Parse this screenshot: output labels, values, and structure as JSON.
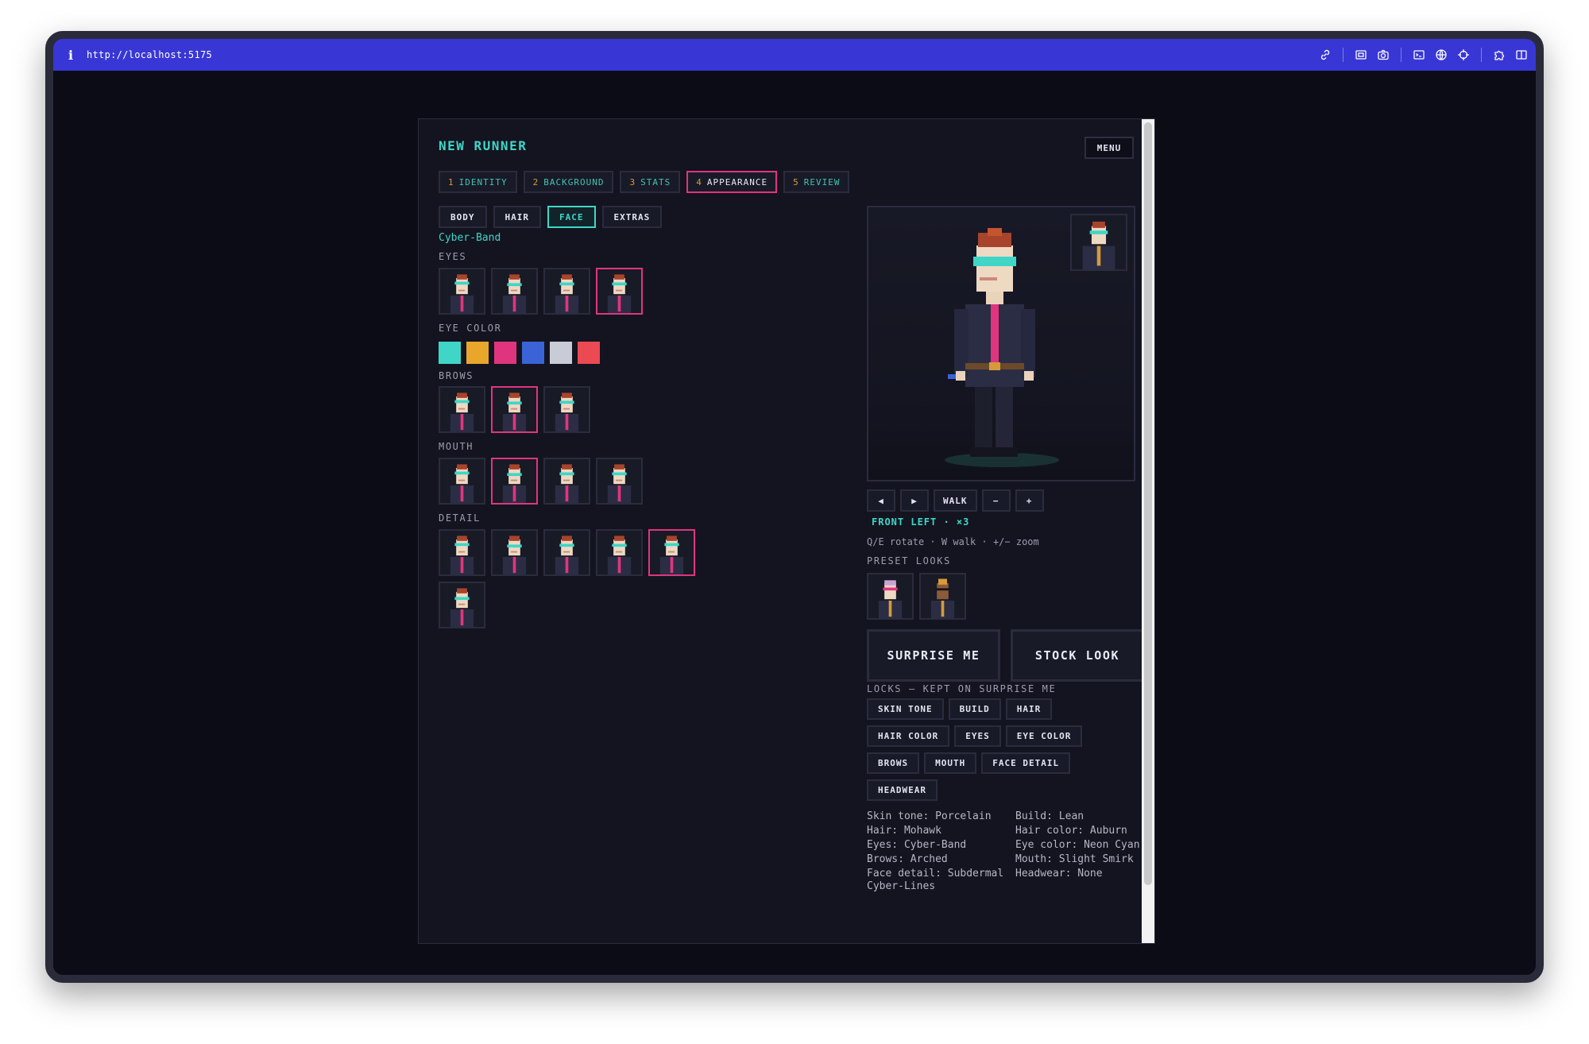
{
  "browser": {
    "url": "http://localhost:5175",
    "icons": [
      "info-icon",
      "link-icon",
      "screenshot-icon",
      "camera-icon",
      "terminal-icon",
      "globe-icon",
      "crosshair-icon",
      "extension-icon",
      "split-view-icon"
    ]
  },
  "app": {
    "title": "NEW RUNNER",
    "menu_label": "MENU",
    "steps": [
      {
        "num": "1",
        "label": "IDENTITY"
      },
      {
        "num": "2",
        "label": "BACKGROUND"
      },
      {
        "num": "3",
        "label": "STATS"
      },
      {
        "num": "4",
        "label": "APPEARANCE",
        "active": true
      },
      {
        "num": "5",
        "label": "REVIEW"
      }
    ],
    "subtabs": [
      "BODY",
      "HAIR",
      "FACE",
      "EXTRAS"
    ],
    "active_subtab": "FACE",
    "selected_name": "Cyber-Band"
  },
  "face": {
    "eyes_label": "EYES",
    "eyes_count": 4,
    "eyes_selected": 4,
    "eye_color_label": "EYE COLOR",
    "eye_colors": [
      "#3fd6c8",
      "#e8a62a",
      "#e0357e",
      "#3b63d8",
      "#c9cbd6",
      "#ec4a52"
    ],
    "eye_color_selected": 1,
    "brows_label": "BROWS",
    "brows_count": 3,
    "brows_selected": 2,
    "mouth_label": "MOUTH",
    "mouth_count": 4,
    "mouth_selected": 2,
    "detail_label": "DETAIL",
    "detail_count": 6,
    "detail_selected": 5
  },
  "preview": {
    "controls": [
      "◀",
      "▶",
      "WALK",
      "−",
      "+"
    ],
    "view_status": "FRONT LEFT · ×3",
    "hint": "Q/E rotate · W walk · +/− zoom",
    "preset_label": "PRESET LOOKS",
    "surprise_label": "SURPRISE ME",
    "stock_label": "STOCK LOOK",
    "locks_label": "LOCKS — KEPT ON SURPRISE ME",
    "locks": [
      "SKIN TONE",
      "BUILD",
      "HAIR",
      "HAIR COLOR",
      "EYES",
      "EYE COLOR",
      "BROWS",
      "MOUTH",
      "FACE DETAIL",
      "HEADWEAR"
    ]
  },
  "summary": [
    "Skin tone: Porcelain",
    "Build: Lean",
    "Hair: Mohawk",
    "Hair color: Auburn",
    "Eyes: Cyber-Band",
    "Eye color: Neon Cyan",
    "Brows: Arched",
    "Mouth: Slight Smirk",
    "Face detail: Subdermal Cyber-Lines",
    "Headwear: None"
  ]
}
